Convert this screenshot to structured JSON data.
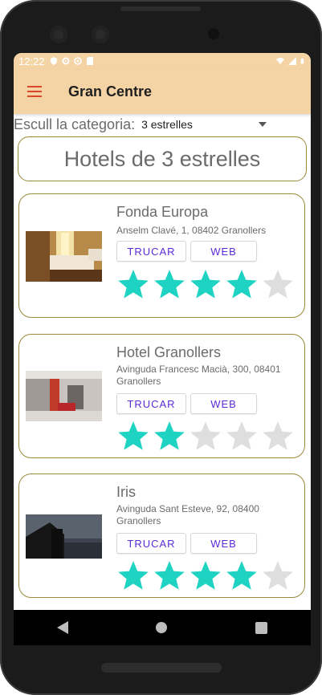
{
  "status_bar": {
    "time": "12:22"
  },
  "app_bar": {
    "title": "Gran Centre"
  },
  "category": {
    "label": "Escull la categoria:",
    "selected": "3 estrelles"
  },
  "heading": "Hotels de 3 estrelles",
  "colors": {
    "accent": "#f4d3a4",
    "star_on": "#1fd3c3",
    "star_off": "#dedede",
    "button_text": "#5b2bd8"
  },
  "hotels": [
    {
      "name": "Fonda Europa",
      "address": "Anselm Clavé, 1, 08402 Granollers",
      "call_label": "TRUCAR",
      "web_label": "WEB",
      "rating": 4,
      "max_rating": 5
    },
    {
      "name": "Hotel Granollers",
      "address": "Avinguda Francesc Macià, 300, 08401 Granollers",
      "call_label": "TRUCAR",
      "web_label": "WEB",
      "rating": 2,
      "max_rating": 5
    },
    {
      "name": "Iris",
      "address": "Avinguda Sant Esteve, 92, 08400 Granollers",
      "call_label": "TRUCAR",
      "web_label": "WEB",
      "rating": 4,
      "max_rating": 5
    }
  ]
}
